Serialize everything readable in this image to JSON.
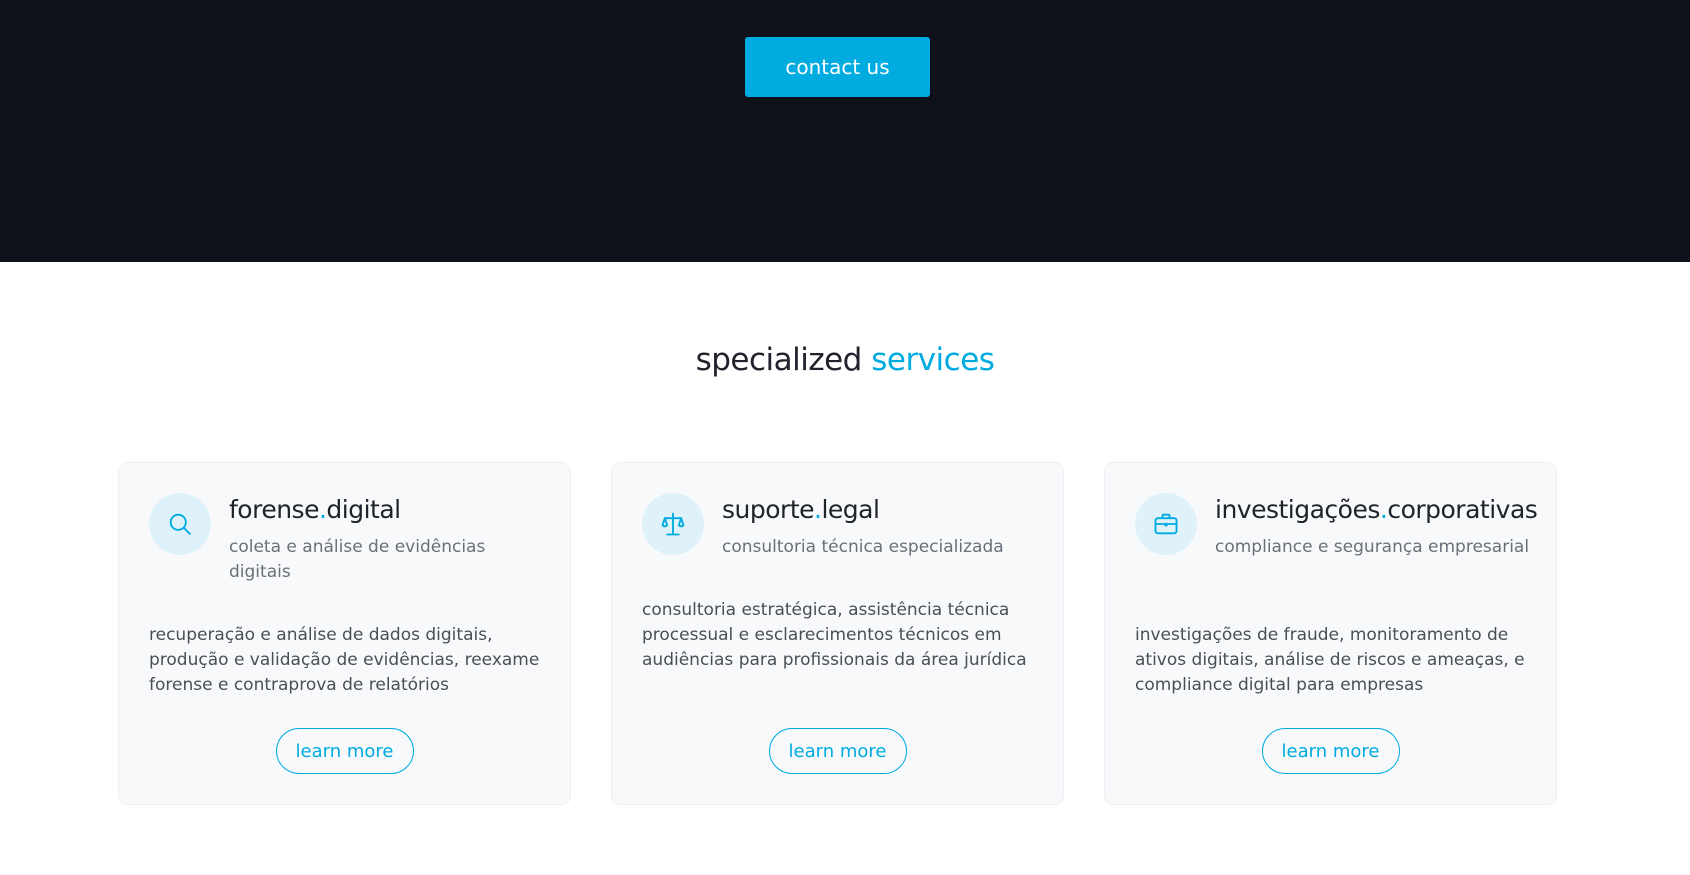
{
  "hero": {
    "contact_label": "contact us"
  },
  "services": {
    "title_part1": "specialized",
    "title_part2": "services",
    "cards": [
      {
        "icon": "search-icon",
        "title_a": "forense",
        "title_dot": ".",
        "title_b": "digital",
        "subtitle": "coleta e análise de evidências digitais",
        "description": "recuperação e análise de dados digitais, produção e validação de evidências, reexame forense e contraprova de relatórios",
        "button": "learn more"
      },
      {
        "icon": "scales-icon",
        "title_a": "suporte",
        "title_dot": ".",
        "title_b": "legal",
        "subtitle": "consultoria técnica especializada",
        "description": "consultoria estratégica, assistência técnica processual e esclarecimentos técnicos em audiências para profissionais da área jurídica",
        "button": "learn more"
      },
      {
        "icon": "briefcase-icon",
        "title_a": "investigações",
        "title_dot": ".",
        "title_b": "corporativas",
        "subtitle": "compliance e segurança empresarial",
        "description": "investigações de fraude, monitoramento de ativos digitais, análise de riscos e ameaças, e compliance digital para empresas",
        "button": "learn more"
      }
    ]
  },
  "colors": {
    "hero_bg": "#0e111a",
    "accent": "#00abe0",
    "card_bg": "#f8f9fb",
    "icon_circle": "#dff2f9"
  }
}
